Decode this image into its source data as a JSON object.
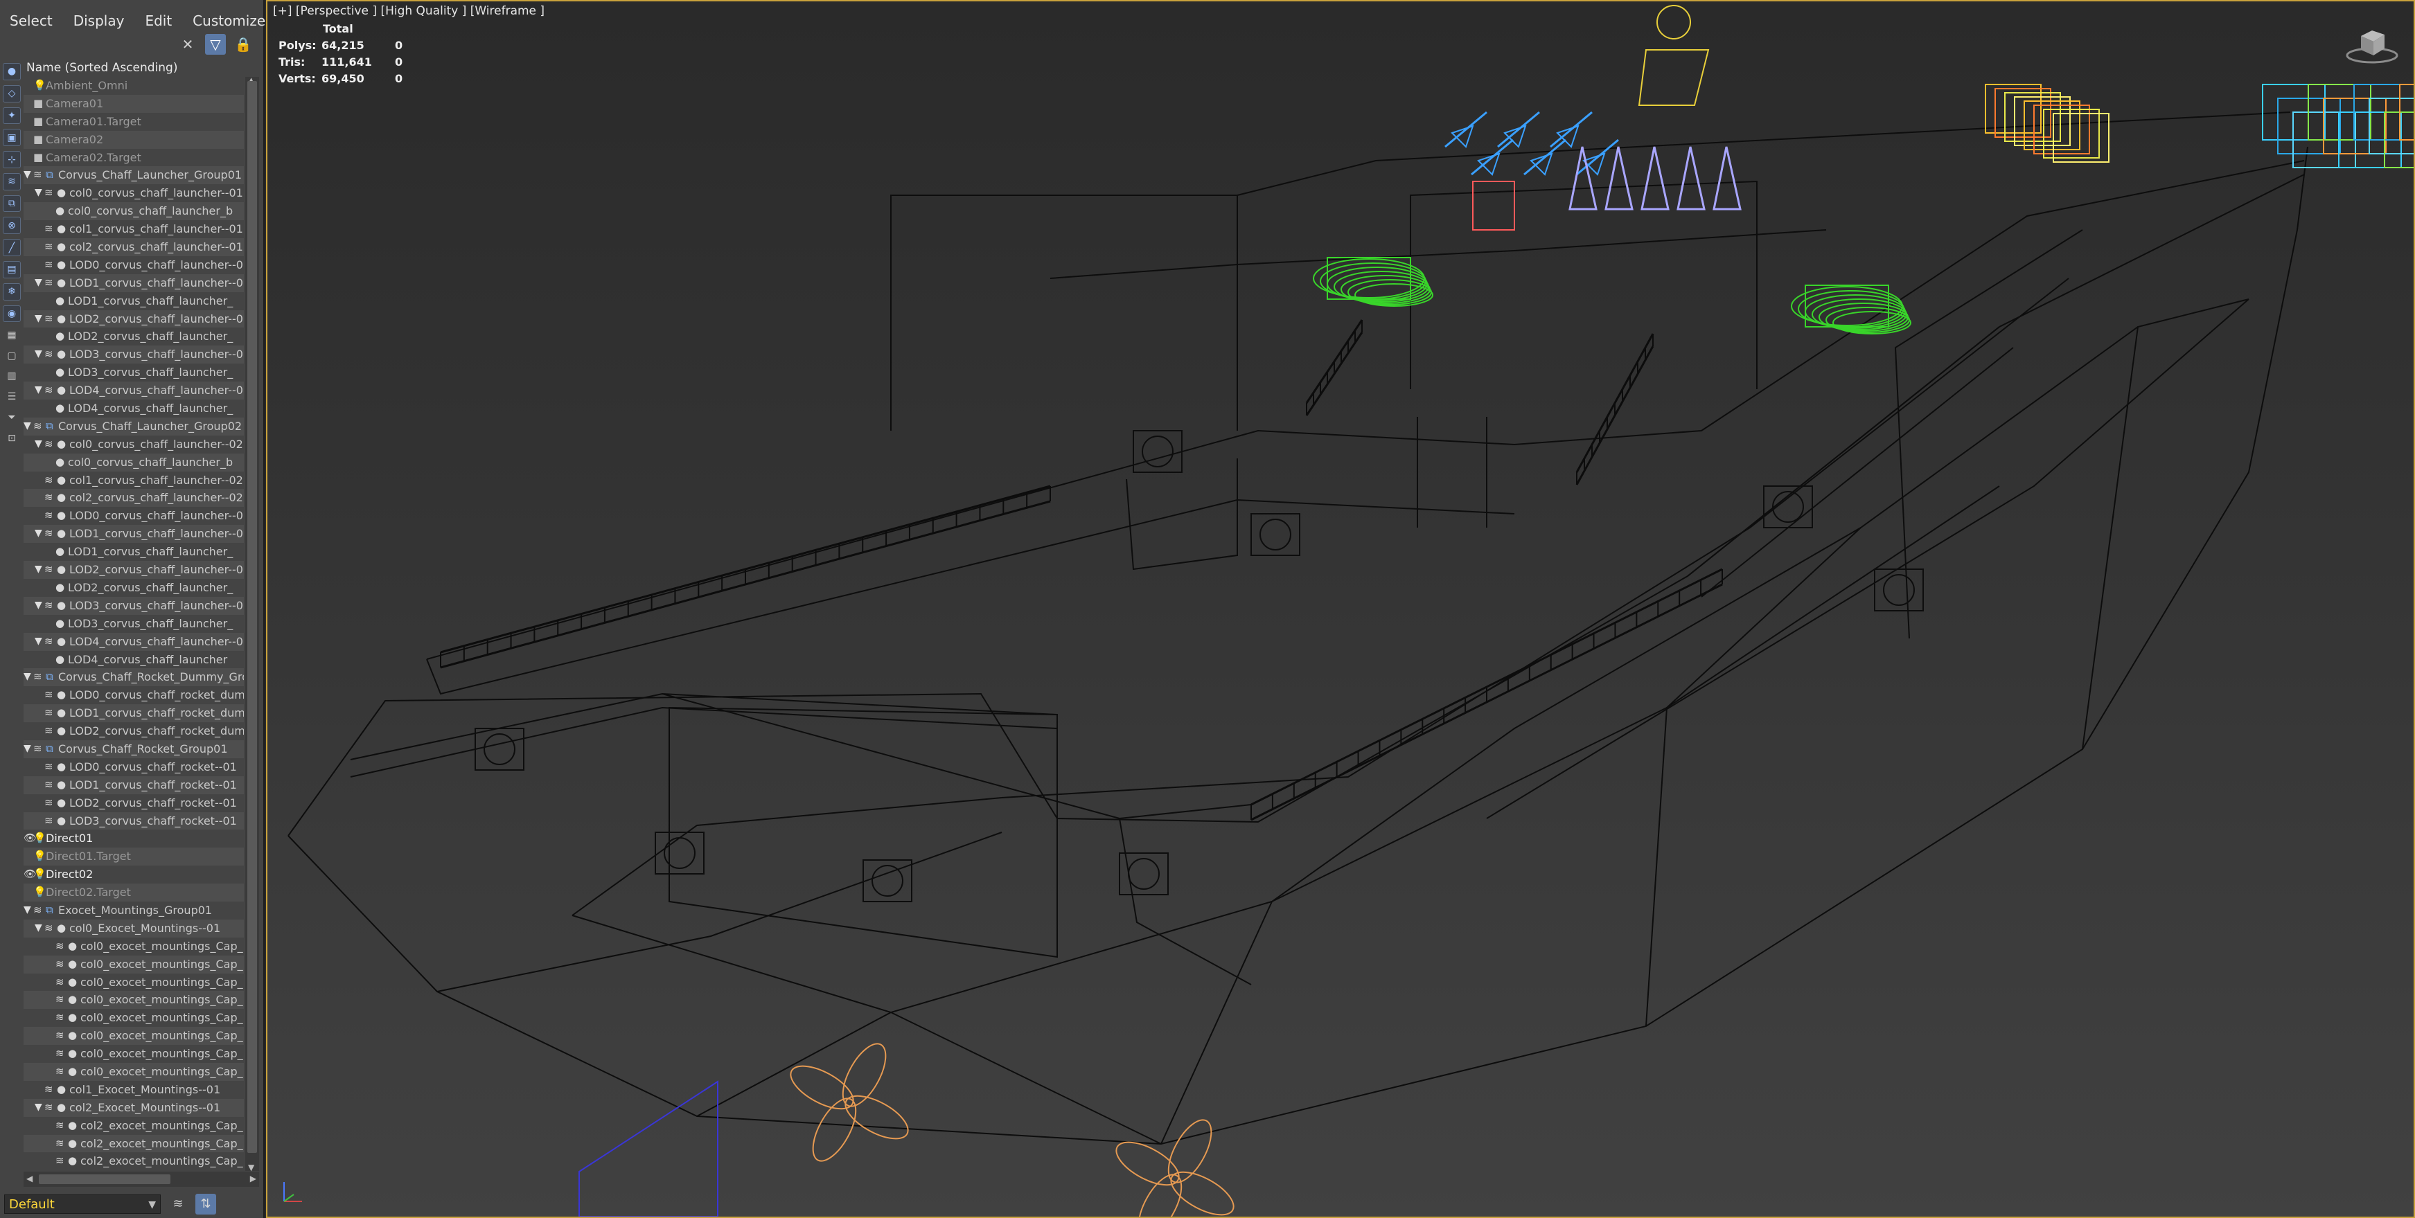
{
  "menu": [
    "Select",
    "Display",
    "Edit",
    "Customize"
  ],
  "tree_header": "Name (Sorted Ascending)",
  "tree": [
    {
      "label": "Ambient_Omni",
      "depth": 0,
      "icon": "light-icon",
      "eye": false,
      "dim": true
    },
    {
      "label": "Camera01",
      "depth": 0,
      "icon": "camera-icon",
      "eye": false,
      "dim": true
    },
    {
      "label": "Camera01.Target",
      "depth": 0,
      "icon": "camera-icon",
      "eye": false,
      "dim": true
    },
    {
      "label": "Camera02",
      "depth": 0,
      "icon": "camera-icon",
      "eye": false,
      "dim": true
    },
    {
      "label": "Camera02.Target",
      "depth": 0,
      "icon": "camera-icon",
      "eye": false,
      "dim": true
    },
    {
      "label": "Corvus_Chaff_Launcher_Group01",
      "depth": 0,
      "icon": "group-icon",
      "expand": true,
      "layer": true
    },
    {
      "label": "col0_corvus_chaff_launcher--01",
      "depth": 1,
      "icon": "object-icon",
      "expand": true,
      "layer": true
    },
    {
      "label": "col0_corvus_chaff_launcher_b",
      "depth": 2,
      "icon": "object-icon"
    },
    {
      "label": "col1_corvus_chaff_launcher--01",
      "depth": 1,
      "icon": "object-icon",
      "layer": true
    },
    {
      "label": "col2_corvus_chaff_launcher--01",
      "depth": 1,
      "icon": "object-icon",
      "layer": true
    },
    {
      "label": "LOD0_corvus_chaff_launcher--0",
      "depth": 1,
      "icon": "object-icon",
      "layer": true
    },
    {
      "label": "LOD1_corvus_chaff_launcher--0",
      "depth": 1,
      "icon": "object-icon",
      "expand": true,
      "layer": true
    },
    {
      "label": "LOD1_corvus_chaff_launcher_",
      "depth": 2,
      "icon": "object-icon"
    },
    {
      "label": "LOD2_corvus_chaff_launcher--0",
      "depth": 1,
      "icon": "object-icon",
      "expand": true,
      "layer": true
    },
    {
      "label": "LOD2_corvus_chaff_launcher_",
      "depth": 2,
      "icon": "object-icon"
    },
    {
      "label": "LOD3_corvus_chaff_launcher--0",
      "depth": 1,
      "icon": "object-icon",
      "expand": true,
      "layer": true
    },
    {
      "label": "LOD3_corvus_chaff_launcher_",
      "depth": 2,
      "icon": "object-icon"
    },
    {
      "label": "LOD4_corvus_chaff_launcher--0",
      "depth": 1,
      "icon": "object-icon",
      "expand": true,
      "layer": true
    },
    {
      "label": "LOD4_corvus_chaff_launcher_",
      "depth": 2,
      "icon": "object-icon"
    },
    {
      "label": "Corvus_Chaff_Launcher_Group02",
      "depth": 0,
      "icon": "group-icon",
      "expand": true,
      "layer": true
    },
    {
      "label": "col0_corvus_chaff_launcher--02",
      "depth": 1,
      "icon": "object-icon",
      "expand": true,
      "layer": true
    },
    {
      "label": "col0_corvus_chaff_launcher_b",
      "depth": 2,
      "icon": "object-icon"
    },
    {
      "label": "col1_corvus_chaff_launcher--02",
      "depth": 1,
      "icon": "object-icon",
      "layer": true
    },
    {
      "label": "col2_corvus_chaff_launcher--02",
      "depth": 1,
      "icon": "object-icon",
      "layer": true
    },
    {
      "label": "LOD0_corvus_chaff_launcher--0",
      "depth": 1,
      "icon": "object-icon",
      "layer": true
    },
    {
      "label": "LOD1_corvus_chaff_launcher--0",
      "depth": 1,
      "icon": "object-icon",
      "expand": true,
      "layer": true
    },
    {
      "label": "LOD1_corvus_chaff_launcher_",
      "depth": 2,
      "icon": "object-icon"
    },
    {
      "label": "LOD2_corvus_chaff_launcher--0",
      "depth": 1,
      "icon": "object-icon",
      "expand": true,
      "layer": true
    },
    {
      "label": "LOD2_corvus_chaff_launcher_",
      "depth": 2,
      "icon": "object-icon"
    },
    {
      "label": "LOD3_corvus_chaff_launcher--0",
      "depth": 1,
      "icon": "object-icon",
      "expand": true,
      "layer": true
    },
    {
      "label": "LOD3_corvus_chaff_launcher_",
      "depth": 2,
      "icon": "object-icon"
    },
    {
      "label": "LOD4_corvus_chaff_launcher--0",
      "depth": 1,
      "icon": "object-icon",
      "expand": true,
      "layer": true
    },
    {
      "label": "LOD4_corvus_chaff_launcher",
      "depth": 2,
      "icon": "object-icon"
    },
    {
      "label": "Corvus_Chaff_Rocket_Dummy_Gro",
      "depth": 0,
      "icon": "group-icon",
      "expand": true,
      "layer": true
    },
    {
      "label": "LOD0_corvus_chaff_rocket_dum",
      "depth": 1,
      "icon": "object-icon",
      "layer": true
    },
    {
      "label": "LOD1_corvus_chaff_rocket_dum",
      "depth": 1,
      "icon": "object-icon",
      "layer": true
    },
    {
      "label": "LOD2_corvus_chaff_rocket_dum",
      "depth": 1,
      "icon": "object-icon",
      "layer": true
    },
    {
      "label": "Corvus_Chaff_Rocket_Group01",
      "depth": 0,
      "icon": "group-icon",
      "expand": true,
      "layer": true
    },
    {
      "label": "LOD0_corvus_chaff_rocket--01",
      "depth": 1,
      "icon": "object-icon",
      "layer": true
    },
    {
      "label": "LOD1_corvus_chaff_rocket--01",
      "depth": 1,
      "icon": "object-icon",
      "layer": true
    },
    {
      "label": "LOD2_corvus_chaff_rocket--01",
      "depth": 1,
      "icon": "object-icon",
      "layer": true
    },
    {
      "label": "LOD3_corvus_chaff_rocket--01",
      "depth": 1,
      "icon": "object-icon",
      "layer": true
    },
    {
      "label": "Direct01",
      "depth": 0,
      "icon": "light-icon",
      "eye": true,
      "bright": true
    },
    {
      "label": "Direct01.Target",
      "depth": 0,
      "icon": "light-icon",
      "eye": false,
      "dim": true
    },
    {
      "label": "Direct02",
      "depth": 0,
      "icon": "light-icon",
      "eye": true,
      "bright": true
    },
    {
      "label": "Direct02.Target",
      "depth": 0,
      "icon": "light-icon",
      "eye": false,
      "dim": true
    },
    {
      "label": "Exocet_Mountings_Group01",
      "depth": 0,
      "icon": "group-icon",
      "expand": true,
      "layer": true
    },
    {
      "label": "col0_Exocet_Mountings--01",
      "depth": 1,
      "icon": "object-icon",
      "expand": true,
      "layer": true
    },
    {
      "label": "col0_exocet_mountings_Cap_",
      "depth": 2,
      "icon": "object-icon",
      "layer": true
    },
    {
      "label": "col0_exocet_mountings_Cap_",
      "depth": 2,
      "icon": "object-icon",
      "layer": true
    },
    {
      "label": "col0_exocet_mountings_Cap_",
      "depth": 2,
      "icon": "object-icon",
      "layer": true
    },
    {
      "label": "col0_exocet_mountings_Cap_",
      "depth": 2,
      "icon": "object-icon",
      "layer": true
    },
    {
      "label": "col0_exocet_mountings_Cap_",
      "depth": 2,
      "icon": "object-icon",
      "layer": true
    },
    {
      "label": "col0_exocet_mountings_Cap_",
      "depth": 2,
      "icon": "object-icon",
      "layer": true
    },
    {
      "label": "col0_exocet_mountings_Cap_",
      "depth": 2,
      "icon": "object-icon",
      "layer": true
    },
    {
      "label": "col0_exocet_mountings_Cap_",
      "depth": 2,
      "icon": "object-icon",
      "layer": true
    },
    {
      "label": "col1_Exocet_Mountings--01",
      "depth": 1,
      "icon": "object-icon",
      "layer": true
    },
    {
      "label": "col2_Exocet_Mountings--01",
      "depth": 1,
      "icon": "object-icon",
      "expand": true,
      "layer": true
    },
    {
      "label": "col2_exocet_mountings_Cap_",
      "depth": 2,
      "icon": "object-icon",
      "layer": true
    },
    {
      "label": "col2_exocet_mountings_Cap_",
      "depth": 2,
      "icon": "object-icon",
      "layer": true
    },
    {
      "label": "col2_exocet_mountings_Cap_",
      "depth": 2,
      "icon": "object-icon",
      "layer": true
    }
  ],
  "layer_dropdown": "Default",
  "viewport": {
    "label": "[+] [Perspective ] [High Quality ] [Wireframe ]",
    "stats": {
      "header": "Total",
      "rows": [
        {
          "name": "Polys:",
          "total": "64,215",
          "sel": "0"
        },
        {
          "name": "Tris:",
          "total": "111,641",
          "sel": "0"
        },
        {
          "name": "Verts:",
          "total": "69,450",
          "sel": "0"
        }
      ]
    }
  },
  "colors": {
    "viewport_border": "#c9a23c",
    "wire": "#0c0c0c",
    "green_launcher": "#39d52a",
    "missile_blue": "#3aa0ff",
    "lilac": "#a9a6ff",
    "orange_prop": "#e69a52",
    "layer_text": "#ffd83a"
  }
}
